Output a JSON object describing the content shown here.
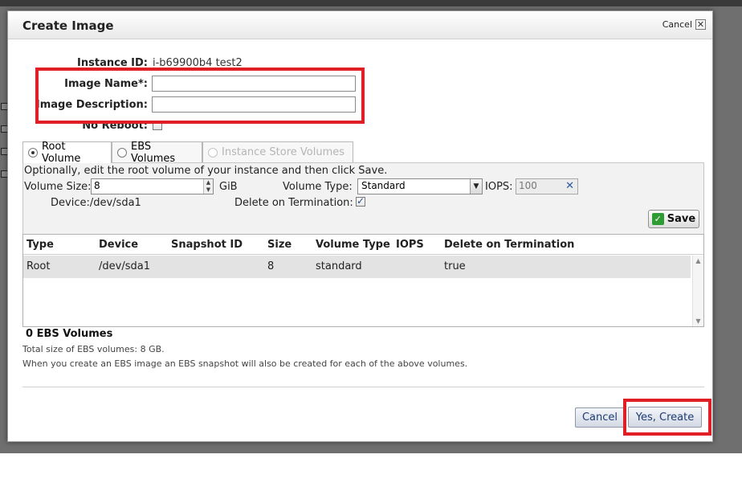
{
  "dialog": {
    "title": "Create Image",
    "header_cancel": "Cancel",
    "close_glyph": "✕"
  },
  "form": {
    "instance_id_label": "Instance ID:",
    "instance_id_value": "i-b69900b4 test2",
    "image_name_label": "Image Name*:",
    "image_name_value": "",
    "image_description_label": "Image Description:",
    "image_description_value": "",
    "no_reboot_label": "No Reboot:",
    "no_reboot_checked": false
  },
  "tabs": [
    {
      "label": "Root Volume",
      "selected": true,
      "enabled": true
    },
    {
      "label": "EBS Volumes",
      "selected": false,
      "enabled": true
    },
    {
      "label": "Instance Store Volumes",
      "selected": false,
      "enabled": false
    }
  ],
  "root_volume": {
    "instructions": "Optionally, edit the root volume of your instance and then click Save.",
    "volume_size_label": "Volume Size:",
    "volume_size_value": "8",
    "volume_size_unit": "GiB",
    "volume_type_label": "Volume Type:",
    "volume_type_value": "Standard",
    "iops_label": "IOPS:",
    "iops_value": "100",
    "device_label": "Device:/dev/sda1",
    "delete_on_termination_label": "Delete on Termination:",
    "delete_on_termination_checked": true,
    "save_label": "Save"
  },
  "volumes_table": {
    "columns": [
      "Type",
      "Device",
      "Snapshot ID",
      "Size",
      "Volume Type",
      "IOPS",
      "Delete on Termination"
    ],
    "rows": [
      {
        "type": "Root",
        "device": "/dev/sda1",
        "snapshot_id": "",
        "size": "8",
        "volume_type": "standard",
        "iops": "",
        "delete_on_termination": "true"
      }
    ]
  },
  "summary": {
    "ebs_count": "0 EBS Volumes",
    "total_size": "Total size of EBS volumes: 8 GB.",
    "note": "When you create an EBS image an EBS snapshot will also be created for each of the above volumes."
  },
  "footer": {
    "cancel_label": "Cancel",
    "create_label": "Yes, Create"
  },
  "colors": {
    "highlight": "#e01e26",
    "save_icon": "#2e9b33",
    "link_blue": "#1d3b73"
  }
}
